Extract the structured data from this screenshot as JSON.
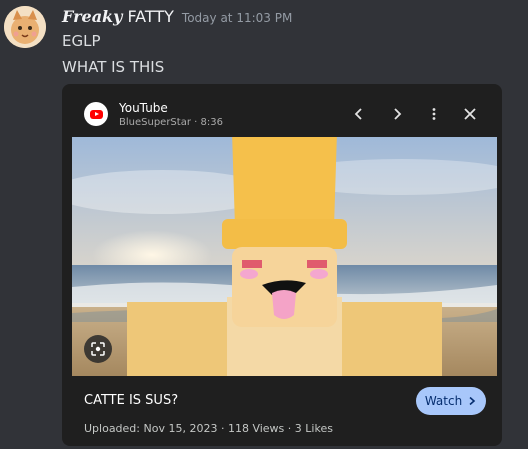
{
  "message": {
    "author_fancy": "Freaky",
    "author_plain": "FATTY",
    "timestamp": "Today at 11:03 PM",
    "lines": [
      "EGLP",
      "WHAT IS THIS"
    ]
  },
  "embed": {
    "site": "YouTube",
    "channel": "BlueSuperStar",
    "separator": "·",
    "duration": "8:36",
    "title": "CATTE IS SUS?",
    "watch_label": "Watch",
    "uploaded": "Uploaded: Nov 15, 2023",
    "views": "118 Views",
    "likes": "3 Likes",
    "icons": [
      "youtube-logo",
      "chevron-left-icon",
      "chevron-right-icon",
      "more-vert-icon",
      "close-icon",
      "lens-icon",
      "chevron-right-icon"
    ]
  },
  "colors": {
    "background": "#313338",
    "embed_bg": "#1f1f1f",
    "watch_button": "#a8c7fa",
    "youtube_red": "#ff0000"
  }
}
